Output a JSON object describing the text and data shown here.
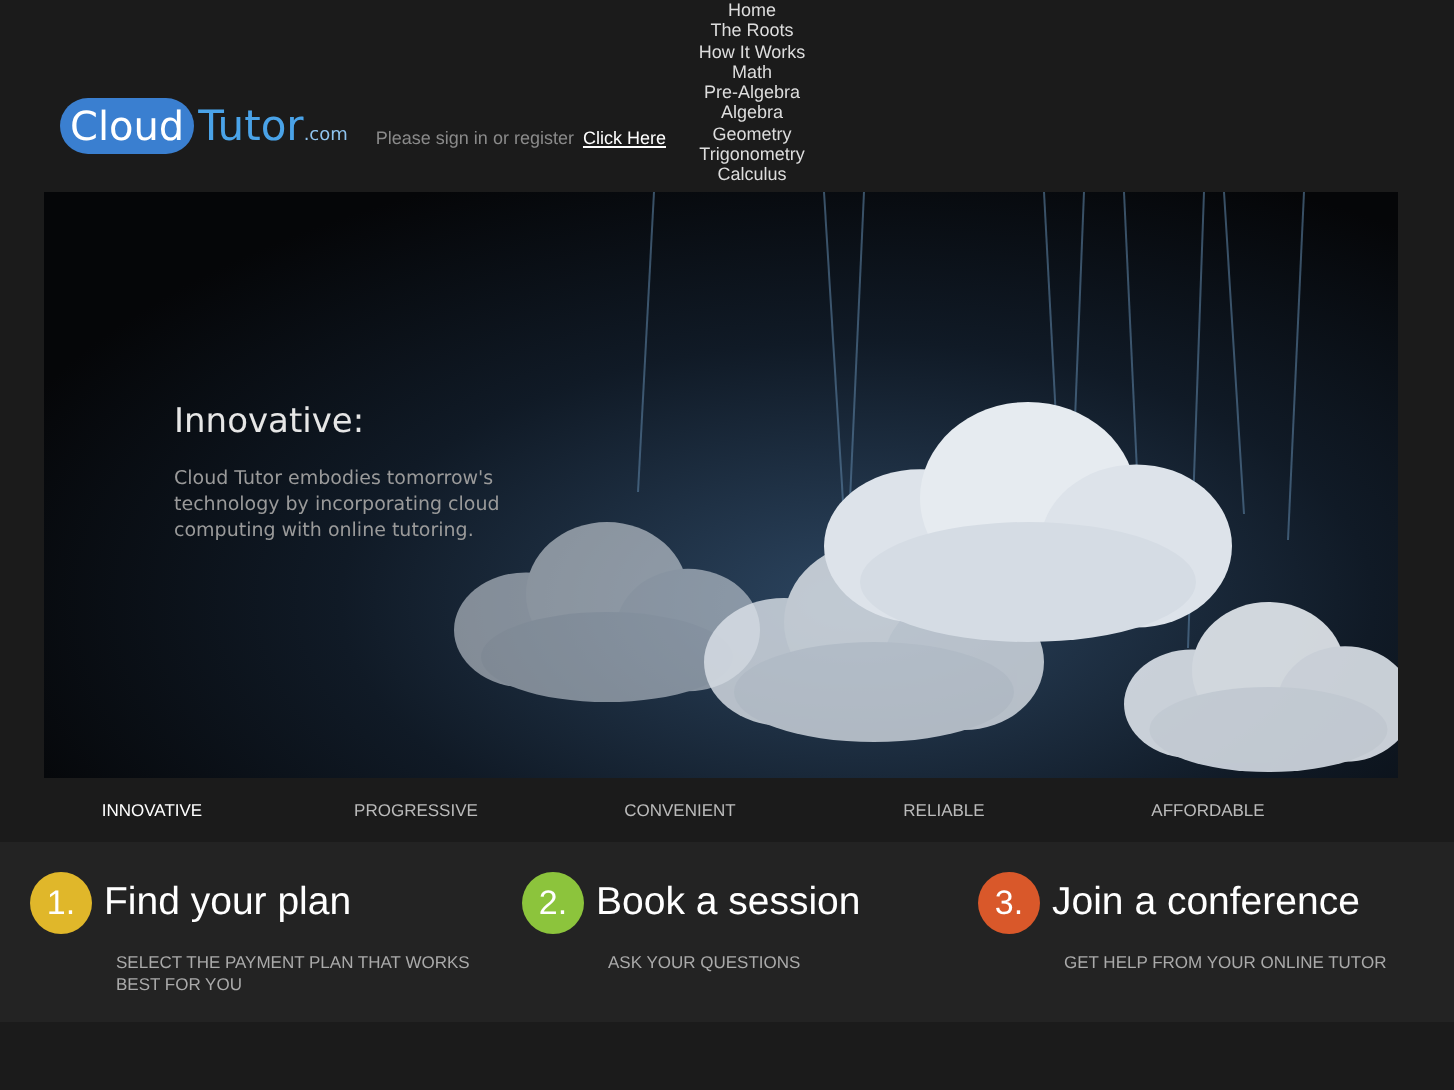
{
  "logo": {
    "word_1": "Cloud",
    "word_2": "Tutor",
    "suffix": ".com"
  },
  "signin": {
    "text": "Please sign in or register",
    "link": "Click Here"
  },
  "nav": [
    "Home",
    "The Roots",
    "How It Works",
    "Math",
    "Pre-Algebra",
    "Algebra",
    "Geometry",
    "Trigonometry",
    "Calculus"
  ],
  "slide": {
    "title": "Innovative:",
    "text": "Cloud Tutor embodies tomorrow's technology by incorporating cloud computing with online tutoring."
  },
  "slide_tabs": [
    {
      "label": "INNOVATIVE",
      "selected": true
    },
    {
      "label": "PROGRESSIVE",
      "selected": false
    },
    {
      "label": "CONVENIENT",
      "selected": false
    },
    {
      "label": "RELIABLE",
      "selected": false
    },
    {
      "label": "AFFORDABLE",
      "selected": false
    }
  ],
  "steps": [
    {
      "number": "1.",
      "title": "Find your plan",
      "subtitle": "SELECT THE PAYMENT PLAN THAT WORKS BEST FOR YOU",
      "color": "#e0b72a"
    },
    {
      "number": "2.",
      "title": "Book a session",
      "subtitle": "ASK YOUR QUESTIONS",
      "color": "#8cc43c"
    },
    {
      "number": "3.",
      "title": "Join a conference",
      "subtitle": "GET HELP FROM YOUR ONLINE TUTOR",
      "color": "#d9582a"
    }
  ]
}
